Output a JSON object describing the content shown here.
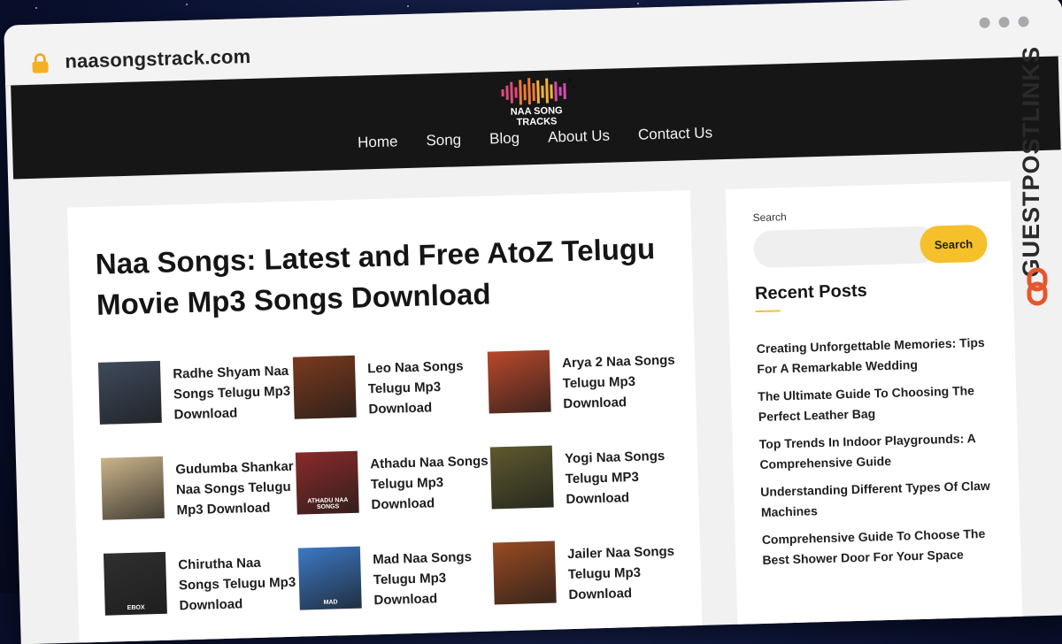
{
  "browser": {
    "url": "naasongstrack.com"
  },
  "site": {
    "logo_line1": "NAA SONG",
    "logo_line2": "TRACKS",
    "nav": [
      "Home",
      "Song",
      "Blog",
      "About Us",
      "Contact Us"
    ]
  },
  "main": {
    "title": "Naa Songs: Latest and Free AtoZ Telugu Movie Mp3 Songs Download",
    "posts": [
      {
        "title": "Radhe Shyam Naa Songs Telugu Mp3 Download",
        "thumb_color": "#3e4a5c",
        "thumb_label": ""
      },
      {
        "title": "Leo Naa Songs Telugu Mp3 Download",
        "thumb_color": "#7a3a1e",
        "thumb_label": ""
      },
      {
        "title": "Arya 2 Naa Songs Telugu Mp3 Download",
        "thumb_color": "#b9482b",
        "thumb_label": ""
      },
      {
        "title": "Gudumba Shankar Naa Songs Telugu Mp3 Download",
        "thumb_color": "#cbb48a",
        "thumb_label": ""
      },
      {
        "title": "Athadu Naa Songs Telugu Mp3 Download",
        "thumb_color": "#8a2a2a",
        "thumb_label": "ATHADU NAA SONGS"
      },
      {
        "title": "Yogi Naa Songs Telugu MP3 Download",
        "thumb_color": "#5d5a2e",
        "thumb_label": ""
      },
      {
        "title": "Chirutha Naa Songs Telugu Mp3 Download",
        "thumb_color": "#2f2f2f",
        "thumb_label": "EBOX"
      },
      {
        "title": "Mad Naa Songs Telugu Mp3 Download",
        "thumb_color": "#3b78c4",
        "thumb_label": "MAD"
      },
      {
        "title": "Jailer Naa Songs Telugu Mp3 Download",
        "thumb_color": "#9a4a22",
        "thumb_label": ""
      }
    ]
  },
  "sidebar": {
    "search_label": "Search",
    "search_placeholder": "",
    "search_button": "Search",
    "recent_title": "Recent Posts",
    "recent_posts": [
      "Creating Unforgettable Memories: Tips For A Remarkable Wedding",
      "The Ultimate Guide To Choosing The Perfect Leather Bag",
      "Top Trends In Indoor Playgrounds: A Comprehensive Guide",
      "Understanding Different Types Of Claw Machines",
      "Comprehensive Guide To Choose The Best Shower Door For Your Space"
    ]
  },
  "watermark": {
    "text": "GUESTPOSTLINKS"
  },
  "colors": {
    "header_bg": "#161616",
    "accent": "#f6c02b",
    "watermark_red": "#e4572e"
  }
}
